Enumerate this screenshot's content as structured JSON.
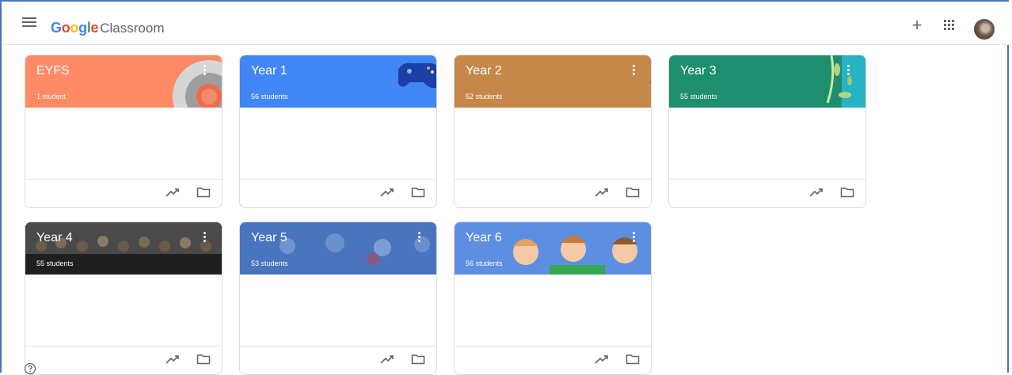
{
  "header": {
    "logo_google": "Google",
    "logo_app": "Classroom",
    "colors": {
      "G": "#4285f4",
      "o1": "#ea4335",
      "o2": "#fbbc05",
      "g": "#4285f4",
      "l": "#34a853",
      "e": "#ea4335"
    },
    "icons": [
      "menu-icon",
      "plus-icon",
      "apps-grid-icon",
      "avatar"
    ]
  },
  "classes": [
    {
      "name": "EYFS",
      "students": "1 student",
      "color": "#ff8a65"
    },
    {
      "name": "Year 1",
      "students": "56 students",
      "color": "#4285f4"
    },
    {
      "name": "Year 2",
      "students": "52 students",
      "color": "#c5884a"
    },
    {
      "name": "Year 3",
      "students": "55 students",
      "color": "#1e8e6e"
    },
    {
      "name": "Year 4",
      "students": "55 students",
      "color": "#3c3c3c"
    },
    {
      "name": "Year 5",
      "students": "53 students",
      "color": "#3f6bb5"
    },
    {
      "name": "Year 6",
      "students": "56 students",
      "color": "#5d8fe0"
    }
  ],
  "footer_icons": [
    "trending-icon",
    "folder-icon"
  ],
  "help_icon": "help-icon"
}
